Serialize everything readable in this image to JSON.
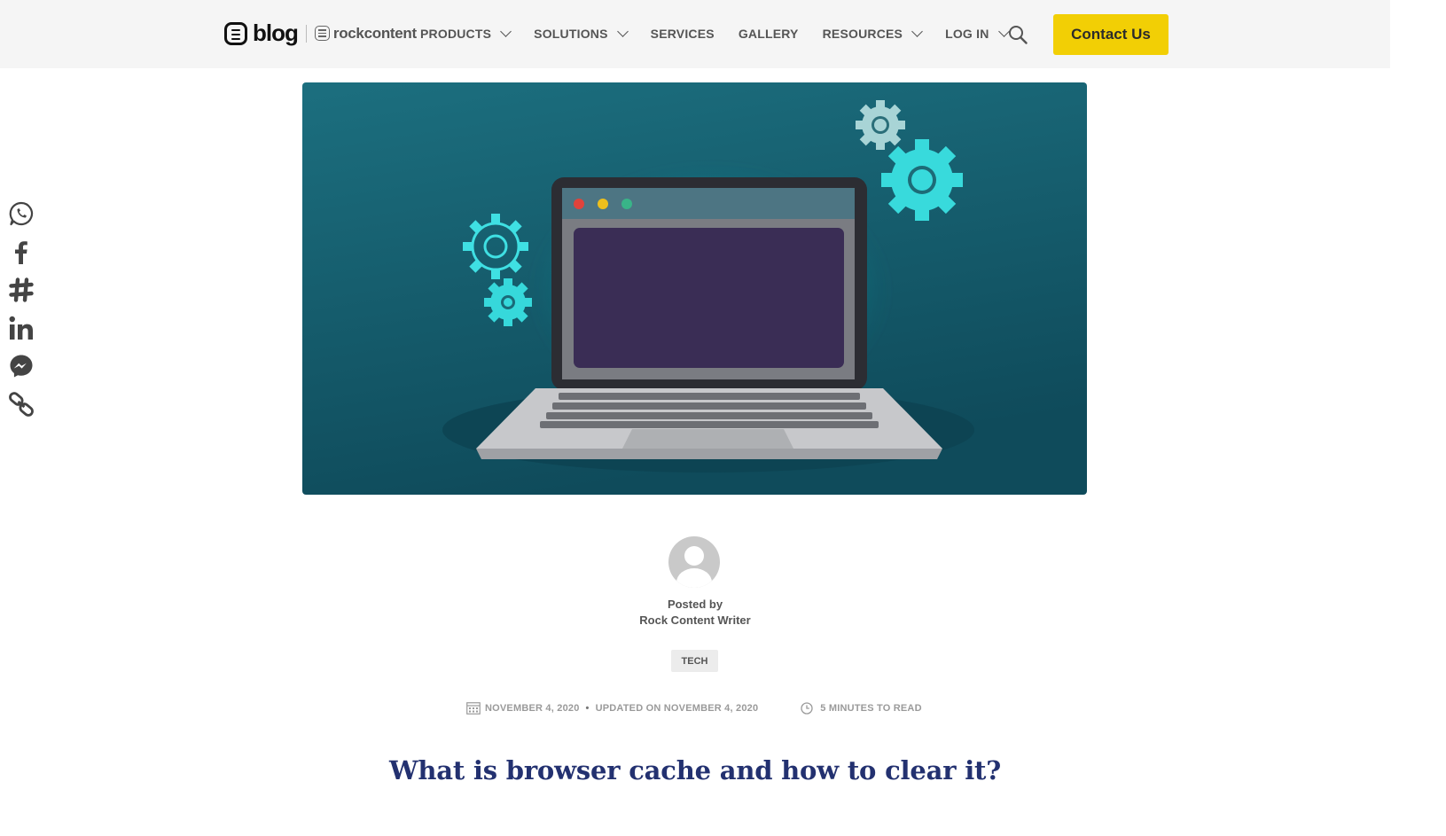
{
  "header": {
    "logo_text": "blog",
    "brand_text": "rockcontent",
    "nav": [
      {
        "label": "PRODUCTS",
        "has_dropdown": true
      },
      {
        "label": "SOLUTIONS",
        "has_dropdown": true
      },
      {
        "label": "SERVICES",
        "has_dropdown": false
      },
      {
        "label": "GALLERY",
        "has_dropdown": false
      },
      {
        "label": "RESOURCES",
        "has_dropdown": true
      },
      {
        "label": "LOG IN",
        "has_dropdown": true
      }
    ],
    "search_icon": "search-icon",
    "contact_label": "Contact Us",
    "contact_color": "#f2cf05"
  },
  "share_icons": [
    "whatsapp-icon",
    "facebook-icon",
    "slack-icon",
    "linkedin-icon",
    "messenger-icon",
    "copy-link-icon"
  ],
  "author": {
    "posted_label": "Posted by",
    "name": "Rock Content Writer"
  },
  "category_tag": "TECH",
  "meta": {
    "published": "NOVEMBER 4, 2020",
    "bullet": "•",
    "updated": "UPDATED ON NOVEMBER 4, 2020",
    "read_time": "5 MINUTES TO READ"
  },
  "article": {
    "title": "What is browser cache and how to clear it?",
    "title_color": "#233170"
  }
}
